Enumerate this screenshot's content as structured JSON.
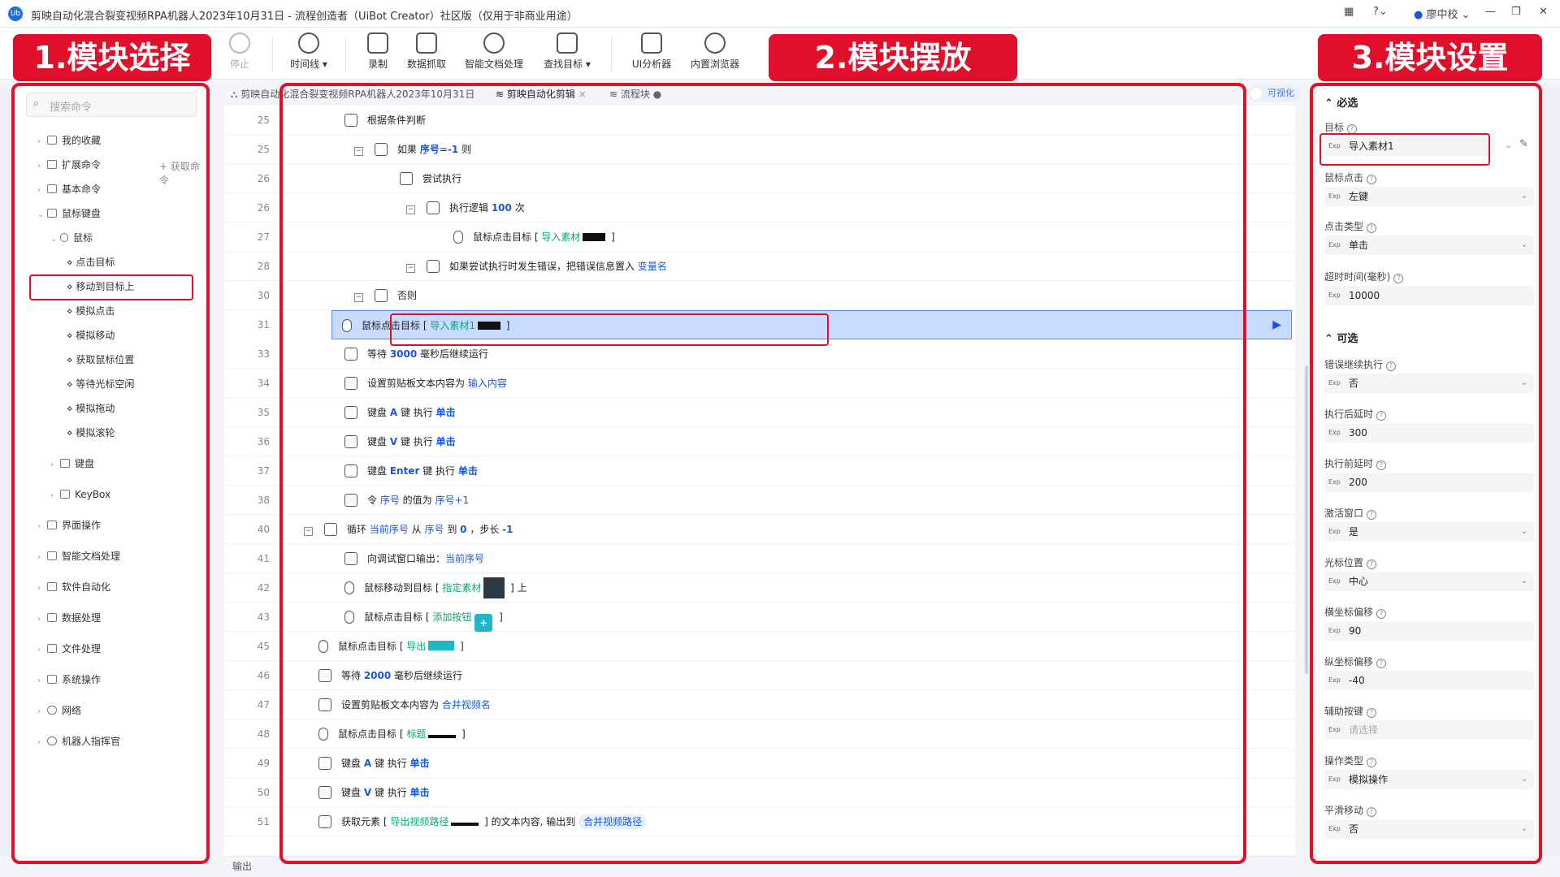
{
  "titlebar": {
    "title": "剪映自动化混合裂变视频RPA机器人2023年10月31日 - 流程创造者（UiBot Creator）社区版（仅用于非商业用途）",
    "user": "廖中校",
    "logo": "Ub"
  },
  "toolbar": {
    "stop": "停止",
    "timeline": "时间线",
    "record": "录制",
    "data_scrape": "数据抓取",
    "smart_doc": "智能文档处理",
    "find_target": "查找目标",
    "ui_analyzer": "UI分析器",
    "browser": "内置浏览器"
  },
  "annotations": {
    "label1": "1.模块选择",
    "label2": "2.模块摆放",
    "label3": "3.模块设置"
  },
  "left": {
    "search_placeholder": "搜索命令",
    "get_cmd": "获取命令",
    "items": [
      "我的收藏",
      "扩展命令",
      "基本命令",
      "鼠标键盘",
      "鼠标",
      "点击目标",
      "移动到目标上",
      "模拟点击",
      "模拟移动",
      "获取鼠标位置",
      "等待光标空闲",
      "模拟拖动",
      "模拟滚轮",
      "键盘",
      "KeyBox",
      "界面操作",
      "智能文档处理",
      "软件自动化",
      "数据处理",
      "文件处理",
      "系统操作",
      "网络",
      "机器人指挥官"
    ]
  },
  "tabs": {
    "tab1": "剪映自动化混合裂变视频RPA机器人2023年10月31日",
    "tab2": "剪映自动化剪辑",
    "tab3": "流程块",
    "visualize": "可视化"
  },
  "rows": [
    {
      "ln": "25",
      "t": [
        "根据条件判断"
      ]
    },
    {
      "ln": "25",
      "t": [
        "如果 ",
        "序号",
        "=",
        "-1",
        " 则"
      ]
    },
    {
      "ln": "26",
      "t": [
        "尝试执行"
      ]
    },
    {
      "ln": "26",
      "t": [
        "执行逻辑 ",
        "100",
        " 次"
      ]
    },
    {
      "ln": "27",
      "t": [
        "鼠标点击目标 [ ",
        "导入素材",
        " ]"
      ]
    },
    {
      "ln": "28",
      "t": [
        "如果尝试执行时发生错误，把错误信息置入 ",
        "变量名"
      ]
    },
    {
      "ln": "30",
      "t": [
        "否则"
      ]
    },
    {
      "ln": "31",
      "t": [
        "鼠标点击目标 [ ",
        "导入素材1",
        " ]"
      ]
    },
    {
      "ln": "33",
      "t": [
        "等待 ",
        "3000",
        " 毫秒后继续运行"
      ]
    },
    {
      "ln": "34",
      "t": [
        "设置剪贴板文本内容为 ",
        "输入内容"
      ]
    },
    {
      "ln": "35",
      "t": [
        "键盘 ",
        "A",
        " 键 执行 ",
        "单击"
      ]
    },
    {
      "ln": "36",
      "t": [
        "键盘 ",
        "V",
        " 键 执行 ",
        "单击"
      ]
    },
    {
      "ln": "37",
      "t": [
        "键盘 ",
        "Enter",
        " 键 执行 ",
        "单击"
      ]
    },
    {
      "ln": "38",
      "t": [
        "令 ",
        "序号",
        " 的值为 ",
        "序号+1"
      ]
    },
    {
      "ln": "40",
      "t": [
        "循环 ",
        "当前序号",
        " 从 ",
        "序号",
        " 到 ",
        "0",
        " ，步长 ",
        "-1"
      ]
    },
    {
      "ln": "41",
      "t": [
        "向调试窗口输出：",
        "当前序号"
      ]
    },
    {
      "ln": "42",
      "t": [
        "鼠标移动到目标 [ ",
        "指定素材",
        " ] 上"
      ]
    },
    {
      "ln": "43",
      "t": [
        "鼠标点击目标 [ ",
        "添加按钮",
        " ]"
      ]
    },
    {
      "ln": "45",
      "t": [
        "鼠标点击目标 [ ",
        "导出",
        " ]"
      ]
    },
    {
      "ln": "46",
      "t": [
        "等待 ",
        "2000",
        " 毫秒后继续运行"
      ]
    },
    {
      "ln": "47",
      "t": [
        "设置剪贴板文本内容为 ",
        "合并视频名"
      ]
    },
    {
      "ln": "48",
      "t": [
        "鼠标点击目标 [ ",
        "标题",
        " ]"
      ]
    },
    {
      "ln": "49",
      "t": [
        "键盘 ",
        "A",
        " 键 执行 ",
        "单击"
      ]
    },
    {
      "ln": "50",
      "t": [
        "键盘 ",
        "V",
        " 键 执行 ",
        "单击"
      ]
    },
    {
      "ln": "51",
      "t": [
        "获取元素 [ ",
        "导出视频路径",
        " ] 的文本内容, 输出到 ",
        "合并视频路径"
      ]
    }
  ],
  "output_label": "输出",
  "right": {
    "required": "必选",
    "optional": "可选",
    "props": [
      {
        "label": "目标",
        "value": "导入素材1"
      },
      {
        "label": "鼠标点击",
        "value": "左键"
      },
      {
        "label": "点击类型",
        "value": "单击"
      },
      {
        "label": "超时时间(毫秒)",
        "value": "10000"
      },
      {
        "label": "错误继续执行",
        "value": "否"
      },
      {
        "label": "执行后延时",
        "value": "300"
      },
      {
        "label": "执行前延时",
        "value": "200"
      },
      {
        "label": "激活窗口",
        "value": "是"
      },
      {
        "label": "光标位置",
        "value": "中心"
      },
      {
        "label": "横坐标偏移",
        "value": "90"
      },
      {
        "label": "纵坐标偏移",
        "value": "-40"
      },
      {
        "label": "辅助按键",
        "value": "请选择"
      },
      {
        "label": "操作类型",
        "value": "模拟操作"
      },
      {
        "label": "平滑移动",
        "value": "否"
      }
    ],
    "exp": "Exp"
  },
  "colors": {
    "accent": "#1a56db",
    "highlight": "#e0102a",
    "selected_row": "#c7dbff",
    "green": "#0aa57a"
  }
}
